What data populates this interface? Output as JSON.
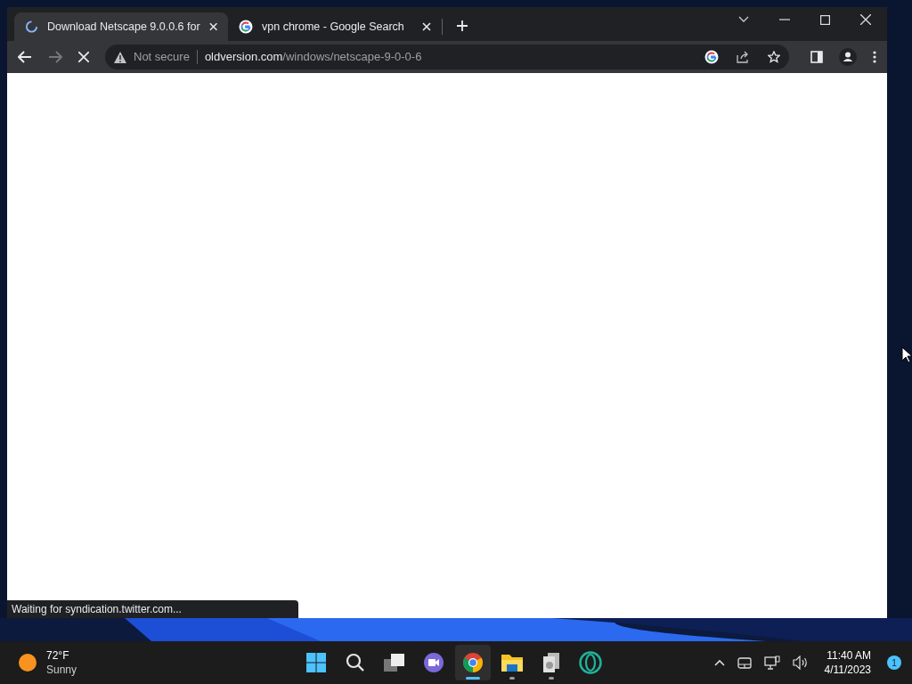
{
  "browser": {
    "tabs": [
      {
        "kind": "loading",
        "title": "Download Netscape 9.0.0.6 for",
        "selected": true
      },
      {
        "kind": "google",
        "title": "vpn chrome - Google Search",
        "selected": false
      }
    ],
    "address_bar": {
      "security": "Not secure",
      "domain": "oldversion.com",
      "path": "/windows/netscape-9-0-0-6"
    },
    "status_bubble": "Waiting for syndication.twitter.com..."
  },
  "taskbar": {
    "weather": {
      "temperature": "72°F",
      "condition": "Sunny"
    },
    "apps": [
      {
        "kind": "start",
        "running": false,
        "selected": false
      },
      {
        "kind": "search",
        "running": false,
        "selected": false
      },
      {
        "kind": "taskview",
        "running": false,
        "selected": false
      },
      {
        "kind": "chat",
        "running": false,
        "selected": false
      },
      {
        "kind": "chrome",
        "running": true,
        "selected": true
      },
      {
        "kind": "explorer",
        "running": true,
        "selected": false
      },
      {
        "kind": "files",
        "running": true,
        "selected": false
      },
      {
        "kind": "opera",
        "running": false,
        "selected": false
      }
    ],
    "clock": {
      "time": "11:40 AM",
      "date": "4/11/2023"
    },
    "notifications": "1"
  }
}
